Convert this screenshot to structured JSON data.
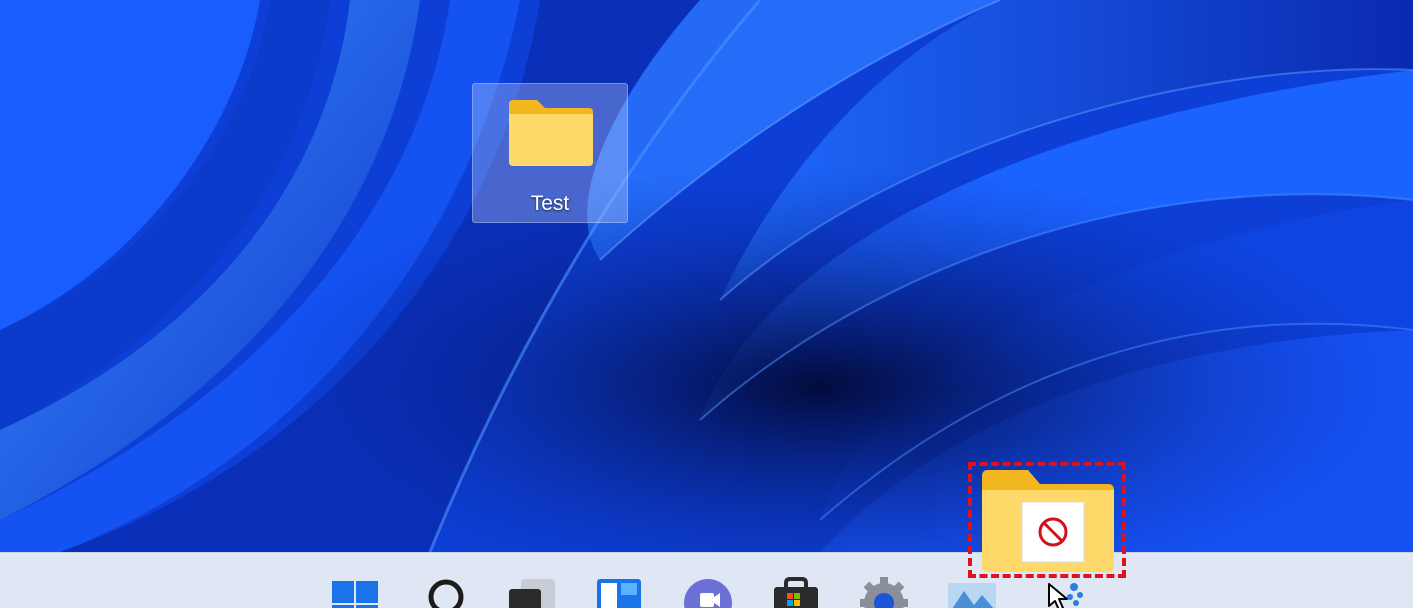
{
  "desktop": {
    "icons": [
      {
        "label": "Test",
        "type": "folder",
        "selected": true
      }
    ]
  },
  "taskbar": {
    "items": [
      {
        "name": "start-button",
        "icon": "windows-logo-icon"
      },
      {
        "name": "search-button",
        "icon": "search-icon"
      },
      {
        "name": "task-view-button",
        "icon": "task-view-icon"
      },
      {
        "name": "widgets-button",
        "icon": "widgets-icon"
      },
      {
        "name": "chat-button",
        "icon": "teams-chat-icon"
      },
      {
        "name": "store-button",
        "icon": "microsoft-store-icon"
      },
      {
        "name": "settings-button",
        "icon": "gear-icon"
      },
      {
        "name": "app-button",
        "icon": "app-icon"
      },
      {
        "name": "app-button-2",
        "icon": "app-icon"
      }
    ]
  },
  "drag": {
    "item": "folder",
    "drop_indicator": "no-entry-icon",
    "highlight_color": "#e0101c"
  },
  "colors": {
    "folder_body": "#ffd86a",
    "folder_tab": "#f2b61f",
    "taskbar_bg": "#dfe7f5",
    "accent_blue": "#0f62d8"
  }
}
